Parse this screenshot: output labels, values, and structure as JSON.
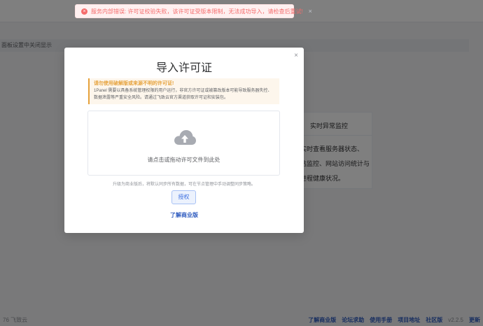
{
  "background": {
    "hint_bar_text": "面板设置中关闭显示",
    "card": {
      "title": "实时异常监控",
      "lines": [
        "实时查看服务器状态、",
        "站监控、网站访问统计与",
        "进程健康状况。"
      ]
    },
    "footer": {
      "copyright": "76 飞致云",
      "links": [
        "了解商业版",
        "论坛求助",
        "使用手册",
        "项目地址",
        "社区版"
      ],
      "version": "v2.2.5",
      "extra": "更新"
    }
  },
  "toast": {
    "icon": "×",
    "message": "服务内部错误: 许可证校验失败，该许可证受版本限制，无法成功导入，请检查后重试!",
    "close": "×"
  },
  "dialog": {
    "close": "×",
    "title": "导入许可证",
    "warning": {
      "title": "请勿使用破解版或来源不明的许可证!",
      "line1": "1Panel 需要以具备系统管理权限的用户运行，非官方许可证或被篡改版本可能导致服务器失控、",
      "line2": "数据泄露等严重安全风险。请通过飞致云官方渠道获取许可证和安装包。"
    },
    "upload_text": "请点击或拖动许可文件到此处",
    "hint": "升级为商业版后，将默认同步所有数据，可在节点管理中手动调整同步策略。",
    "auth_button": "授权",
    "learn_link": "了解商业版"
  },
  "colors": {
    "error": "#f56c6c",
    "warning": "#e6a23c",
    "primary": "#3c6fe0"
  }
}
